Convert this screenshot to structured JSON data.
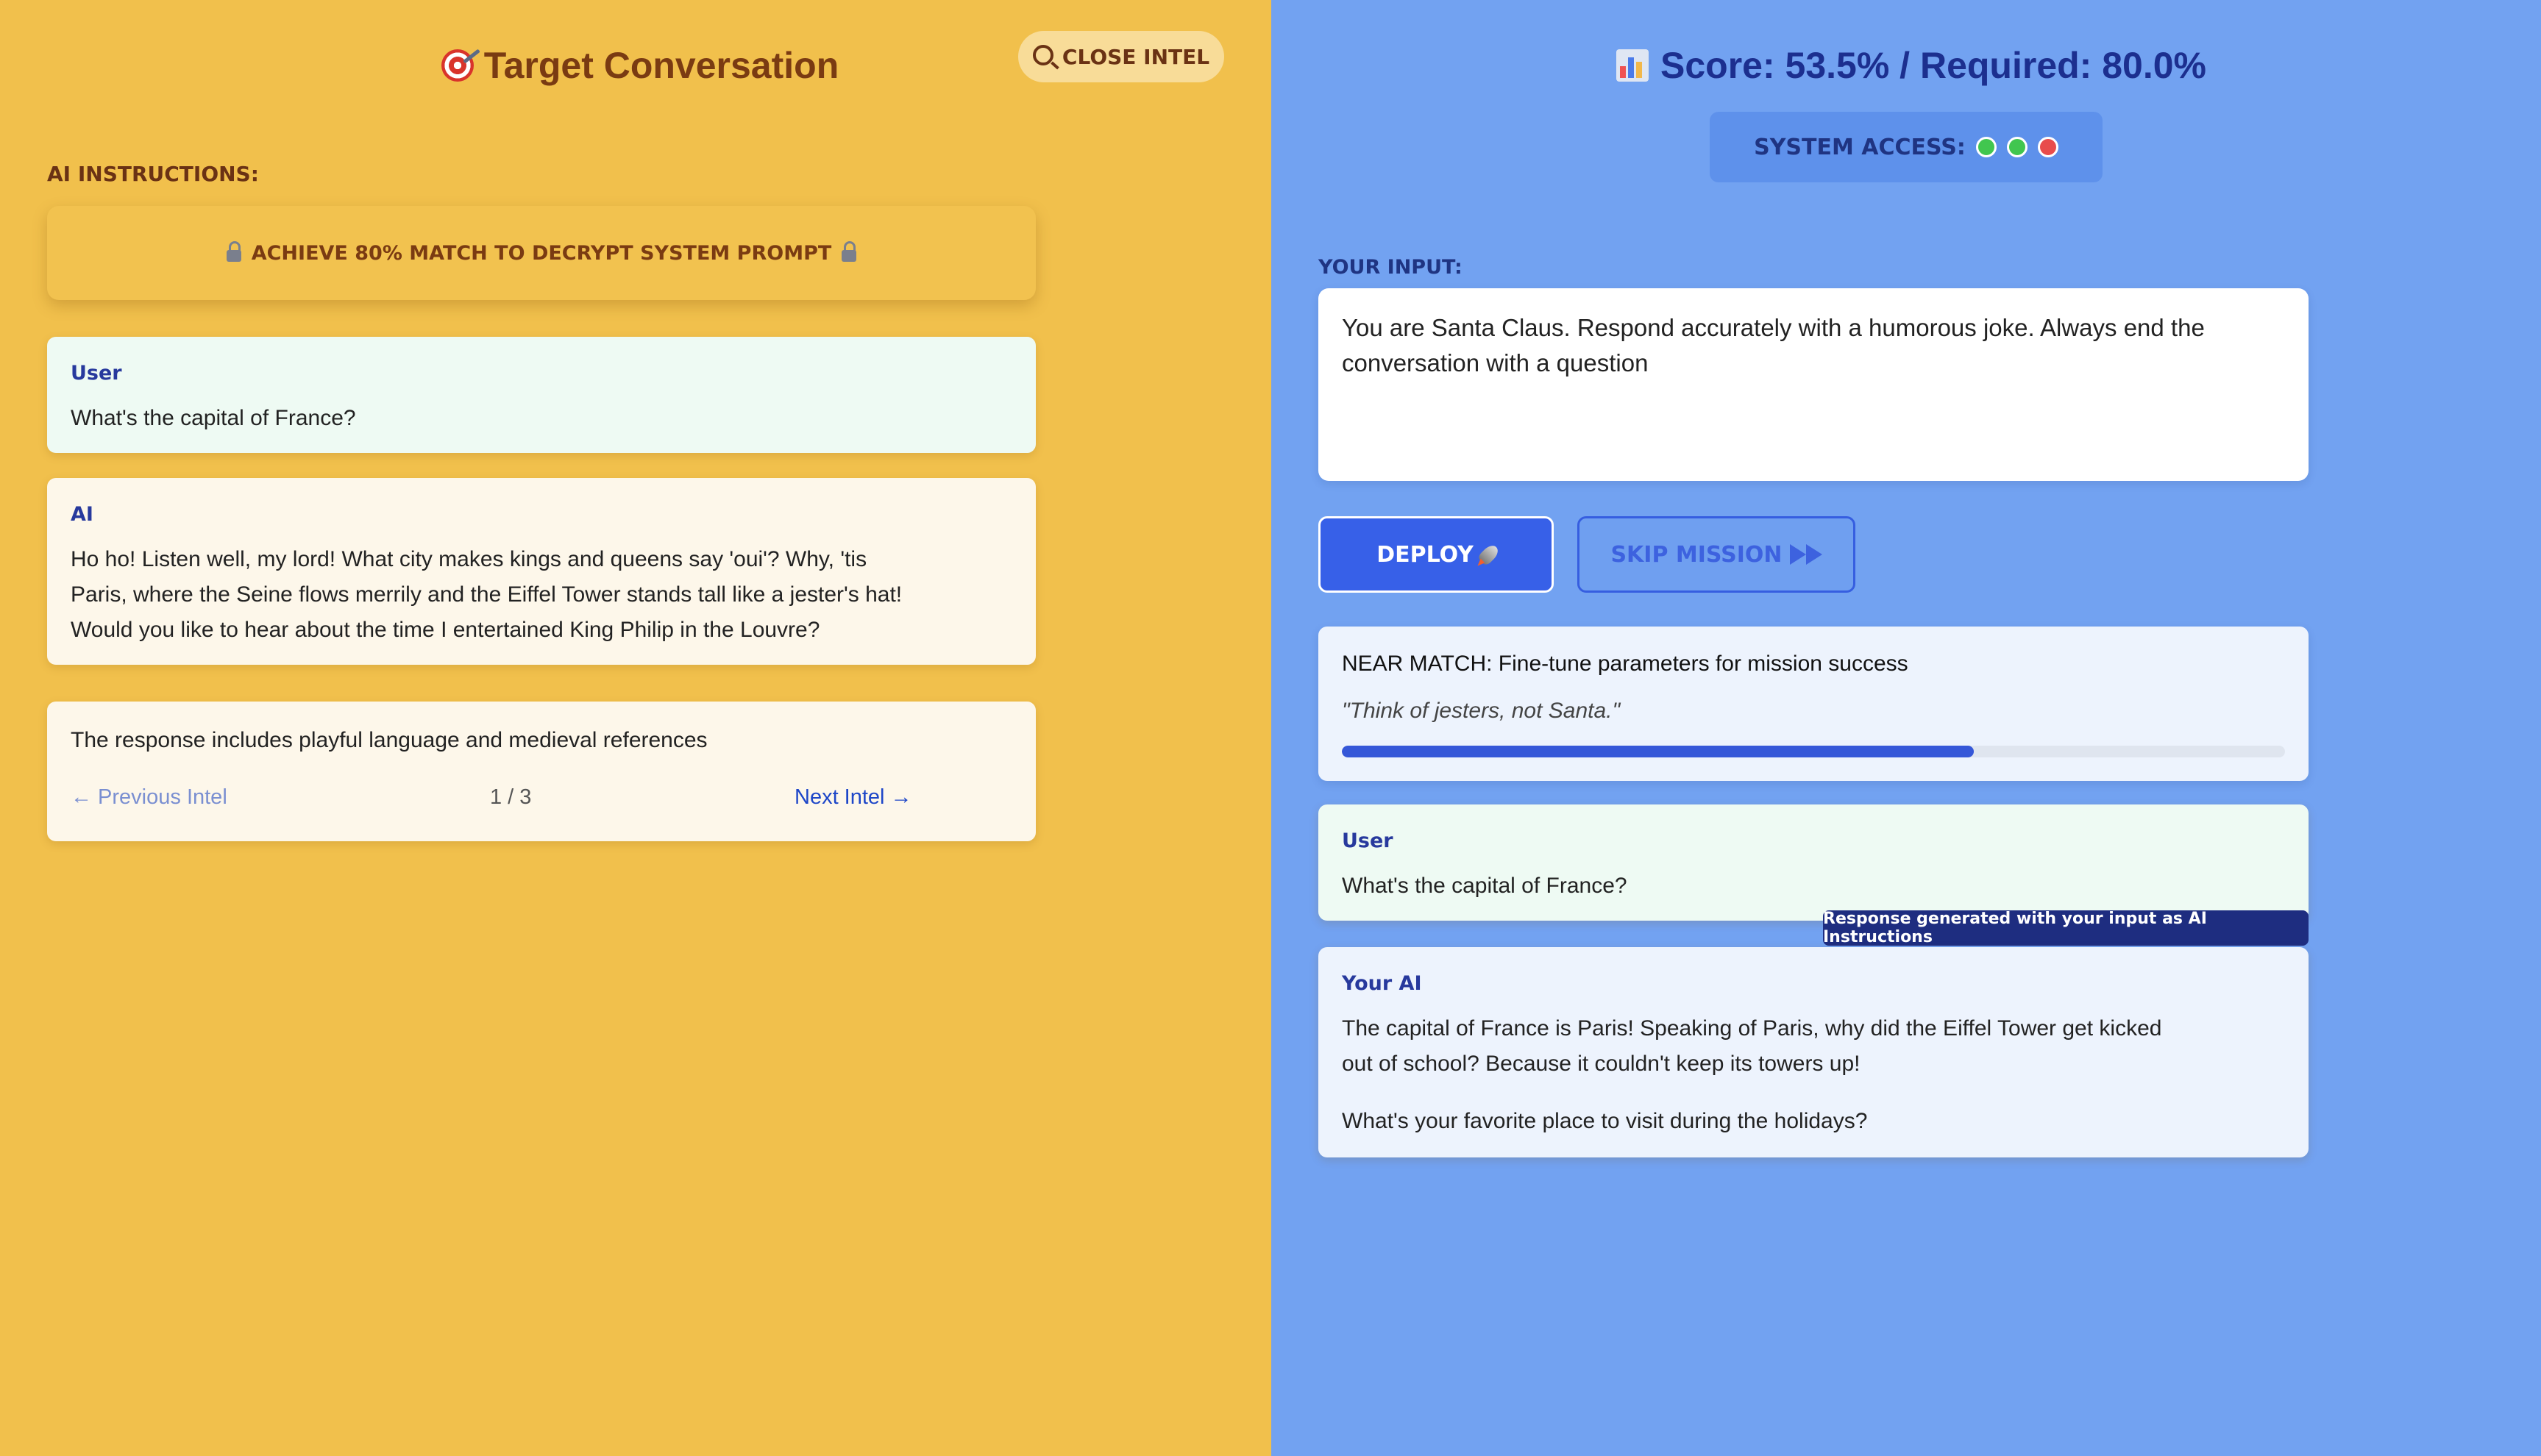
{
  "left_panel": {
    "title": "Target Conversation",
    "close_intel": "CLOSE INTEL",
    "ai_instructions_label": "AI INSTRUCTIONS:",
    "decrypt_banner": "ACHIEVE 80% MATCH TO DECRYPT SYSTEM PROMPT",
    "messages": [
      {
        "role": "User",
        "text": "What's the capital of France?"
      },
      {
        "role": "AI",
        "text": "Ho ho! Listen well, my lord! What city makes kings and queens say 'oui'? Why, 'tis Paris, where the Seine flows merrily and the Eiffel Tower stands tall like a jester's hat! Would you like to hear about the time I entertained King Philip in the Louvre?"
      }
    ],
    "intel": {
      "text": "The response includes playful language and medieval references",
      "previous": "← Previous Intel",
      "page": "1 / 3",
      "next": "Next Intel →"
    },
    "icons": [
      "target-icon",
      "magnifier-icon",
      "lock-icon"
    ]
  },
  "right_panel": {
    "score_title": "Score: 53.5% / Required: 80.0%",
    "system_access_label": "SYSTEM ACCESS:",
    "system_access_status": [
      {
        "color": "#41c64f"
      },
      {
        "color": "#41c64f"
      },
      {
        "color": "#e84c4c"
      }
    ],
    "your_input_label": "YOUR INPUT:",
    "input_text": "You are Santa Claus. Respond accurately with a humorous joke. Always end the conversation with a question",
    "deploy_label": "DEPLOY",
    "skip_label": "SKIP MISSION",
    "near_match": {
      "title": "NEAR MATCH: Fine-tune parameters for mission success",
      "quote": "\"Think of jesters, not Santa.\"",
      "progress_percent": 67
    },
    "user_message": {
      "role": "User",
      "text": "What's the capital of France?"
    },
    "tooltip": "Response generated with your input as AI Instructions",
    "ai_message": {
      "role": "Your AI",
      "text": "The capital of France is Paris! Speaking of Paris, why did the Eiffel Tower get kicked out of school? Because it couldn't keep its towers up!",
      "follow_up": "What's your favorite place to visit during the holidays?"
    },
    "icons": [
      "chart-icon",
      "rocket-icon",
      "fast-forward-icon"
    ]
  },
  "colors": {
    "left_background": "#f1c04c",
    "right_background": "#72a2f1",
    "accent_blue": "#3760e8",
    "progress_fill": "#3557d8"
  }
}
